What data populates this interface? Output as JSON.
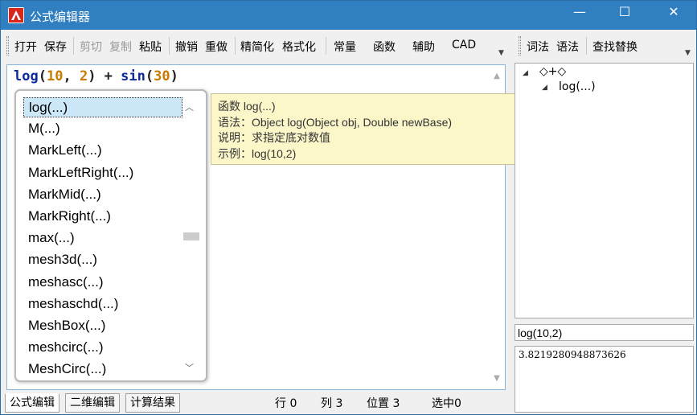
{
  "window": {
    "title": "公式编辑器",
    "minimize_glyph": "—",
    "maximize_glyph": "☐",
    "close_glyph": "✕"
  },
  "toolbar": {
    "open": "打开",
    "save": "保存",
    "cut": "剪切",
    "copy": "复制",
    "paste": "粘贴",
    "undo": "撤销",
    "redo": "重做",
    "simplify": "精简化",
    "format": "格式化",
    "constants": "常量",
    "functions": "函数",
    "helpers": "辅助",
    "cad": "CAD"
  },
  "right_toolbar": {
    "lexical": "词法",
    "syntax": "语法",
    "find_replace": "查找替换"
  },
  "editor": {
    "formula_tokens": [
      {
        "text": "log",
        "kind": "func"
      },
      {
        "text": "(",
        "kind": "plain"
      },
      {
        "text": "10",
        "kind": "num"
      },
      {
        "text": ", ",
        "kind": "plain"
      },
      {
        "text": "2",
        "kind": "num"
      },
      {
        "text": ") + ",
        "kind": "plain"
      },
      {
        "text": "sin",
        "kind": "func"
      },
      {
        "text": "(",
        "kind": "plain"
      },
      {
        "text": "30",
        "kind": "num"
      },
      {
        "text": ")",
        "kind": "plain"
      }
    ]
  },
  "completion": {
    "selected_index": 0,
    "items": [
      "log(...)",
      "M(...)",
      "MarkLeft(...)",
      "MarkLeftRight(...)",
      "MarkMid(...)",
      "MarkRight(...)",
      "max(...)",
      "mesh3d(...)",
      "meshasc(...)",
      "meshaschd(...)",
      "MeshBox(...)",
      "meshcirc(...)",
      "MeshCirc(...)"
    ]
  },
  "tooltip": {
    "line1": "函数 log(...)",
    "line2": "语法：Object log(Object obj, Double newBase)",
    "line3": "说明：求指定底对数值",
    "line4": "示例：log(10,2)"
  },
  "tree": {
    "root": "◇+◇",
    "child": "log(...)"
  },
  "result": {
    "expression": "log(10,2)",
    "value": "3.8219280948873626"
  },
  "bottom_tabs": {
    "formula_edit": "公式编辑",
    "two_d_edit": "二维编辑",
    "calc_result": "计算结果"
  },
  "status": {
    "row": "行 0",
    "col": "列 3",
    "position": "位置 3",
    "selected": "选中0"
  },
  "colors": {
    "titlebar": "#2f7fc1",
    "selection": "#cce8f8",
    "tooltip_bg": "#fbf7c9",
    "function_token": "#0a2a9a",
    "number_token": "#c97c00"
  }
}
